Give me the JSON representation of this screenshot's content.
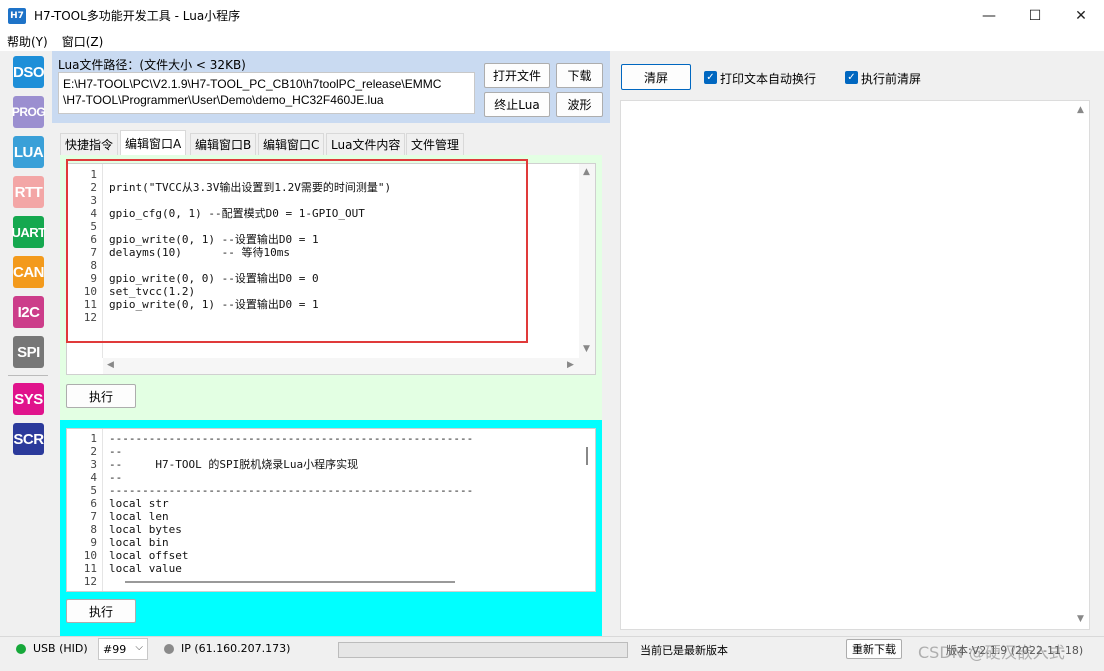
{
  "window": {
    "app_icon_text": "H7",
    "title": "H7-TOOL多功能开发工具 - Lua小程序",
    "minimize": "—",
    "maximize": "☐",
    "close": "✕"
  },
  "menu": [
    {
      "label": "帮助(Y)"
    },
    {
      "label": "窗口(Z)"
    }
  ],
  "sidebar": [
    {
      "label": "DSO",
      "color": "#1e8fd8"
    },
    {
      "label": "PROG",
      "color": "#9b8fd0"
    },
    {
      "label": "LUA",
      "color": "#3aa0d8"
    },
    {
      "label": "RTT",
      "color": "#f3a6a6"
    },
    {
      "label": "UART",
      "color": "#15a84f"
    },
    {
      "label": "CAN",
      "color": "#f39a1c"
    },
    {
      "label": "I2C",
      "color": "#cc3d8a"
    },
    {
      "label": "SPI",
      "color": "#777777"
    },
    {
      "label": "SYS",
      "color": "#e0138c"
    },
    {
      "label": "SCR",
      "color": "#2b3a9b"
    }
  ],
  "lua_file": {
    "label": "Lua文件路径：(文件大小 < 32KB)",
    "path_line1": "E:\\H7-TOOL\\PC\\V2.1.9\\H7-TOOL_PC_CB10\\h7toolPC_release\\EMMC",
    "path_line2": "\\H7-TOOL\\Programmer\\User\\Demo\\demo_HC32F460JE.lua",
    "open_button": "打开文件",
    "download_button": "下载",
    "stop_button": "终止Lua",
    "wave_button": "波形"
  },
  "tabs": [
    {
      "label": "快捷指令"
    },
    {
      "label": "编辑窗口A"
    },
    {
      "label": "编辑窗口B"
    },
    {
      "label": "编辑窗口C"
    },
    {
      "label": "Lua文件内容"
    },
    {
      "label": "文件管理"
    }
  ],
  "editor_a": {
    "line_numbers": "1\n2\n3\n4\n5\n6\n7\n8\n9\n10\n11\n12",
    "code": "\nprint(\"TVCC从3.3V输出设置到1.2V需要的时间测量\")\n\ngpio_cfg(0, 1) --配置模式D0 = 1-GPIO_OUT\n\ngpio_write(0, 1) --设置输出D0 = 1\ndelayms(10)      -- 等待10ms\n\ngpio_write(0, 0) --设置输出D0 = 0\nset_tvcc(1.2)\ngpio_write(0, 1) --设置输出D0 = 1\n",
    "run_button": "执行"
  },
  "editor_b": {
    "line_numbers": "1\n2\n3\n4\n5\n6\n7\n8\n9\n10\n11\n12",
    "code": "-------------------------------------------------------\n--\n--     H7-TOOL 的SPI脱机烧录Lua小程序实现\n--\n-------------------------------------------------------\nlocal str\nlocal len\nlocal bytes\nlocal bin\nlocal offset\nlocal value\n",
    "run_button": "执行"
  },
  "right_panel": {
    "clear_button": "清屏",
    "auto_wrap_label": "打印文本自动换行",
    "clear_before_run_label": "执行前清屏"
  },
  "status": {
    "usb": "USB (HID)",
    "device": "#99",
    "ip": "IP (61.160.207.173)",
    "latest": "当前已是最新版本",
    "redownload": "重新下载",
    "version": "版本:V2.1.9 (2022-11-18)",
    "watermark": "CSDN @硬汉嵌入式"
  }
}
